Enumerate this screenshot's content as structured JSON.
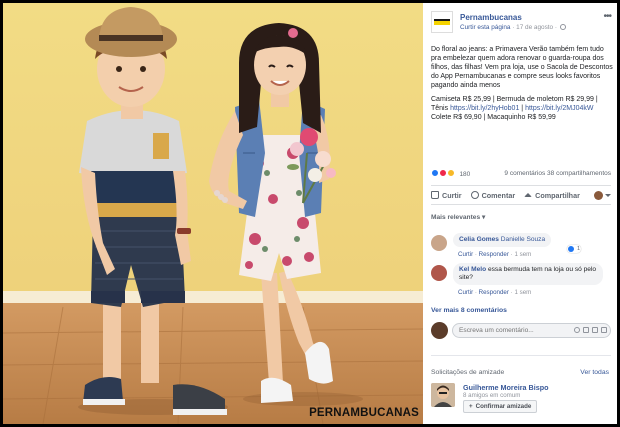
{
  "photo": {
    "watermark": "PERNAMBUCANAS"
  },
  "post": {
    "page_name": "Pernambucanas",
    "like_page": "Curtir esta página",
    "date": "17 de agosto",
    "paragraph_1": "Do floral ao jeans: a Primavera Verão também fem tudo pra embelezar quem adora renovar o guarda-roupa dos filhos, das filhas! Vem pra loja, use o Sacola de Descontos do App Pernambucanas e compre seus looks favoritos pagando ainda menos",
    "paragraph_2": "Camiseta R$ 25,99 | Bermuda de moletom R$ 29,99 | Tênis",
    "link_1": "https://bit.ly/2hyHob01",
    "link_2": "https://bit.ly/2MJ04kW",
    "paragraph_3": "Colete R$ 69,90 | Macaquinho R$ 59,99"
  },
  "reactions": {
    "count": "180",
    "right_text": "9 comentários 38 compartilhamentos"
  },
  "actions": {
    "like": "Curtir",
    "comment": "Comentar",
    "share": "Compartilhar"
  },
  "comments_filter": "Mais relevantes",
  "comments": [
    {
      "author": "Celia Gomes",
      "text": "Danielle Souza",
      "like": "Curtir",
      "reply": "Responder",
      "time": "1 sem",
      "reaction_count": "1"
    },
    {
      "author": "Kel Melo",
      "text": "essa bermuda tem na loja ou só pelo site?",
      "like": "Curtir",
      "reply": "Responder",
      "time": "1 sem"
    }
  ],
  "more_comments": "Ver mais 8 comentários",
  "write_placeholder": "Escreva um comentário...",
  "friends": {
    "title": "Solicitações de amizade",
    "see_all": "Ver todas",
    "name": "Guilherme Moreira Bispo",
    "mutual": "8 amigos em comum",
    "confirm": "Confirmar amizade"
  },
  "colors": {
    "background_wall": "#f0d77f",
    "floor": "#c28a52",
    "link": "#385898"
  }
}
